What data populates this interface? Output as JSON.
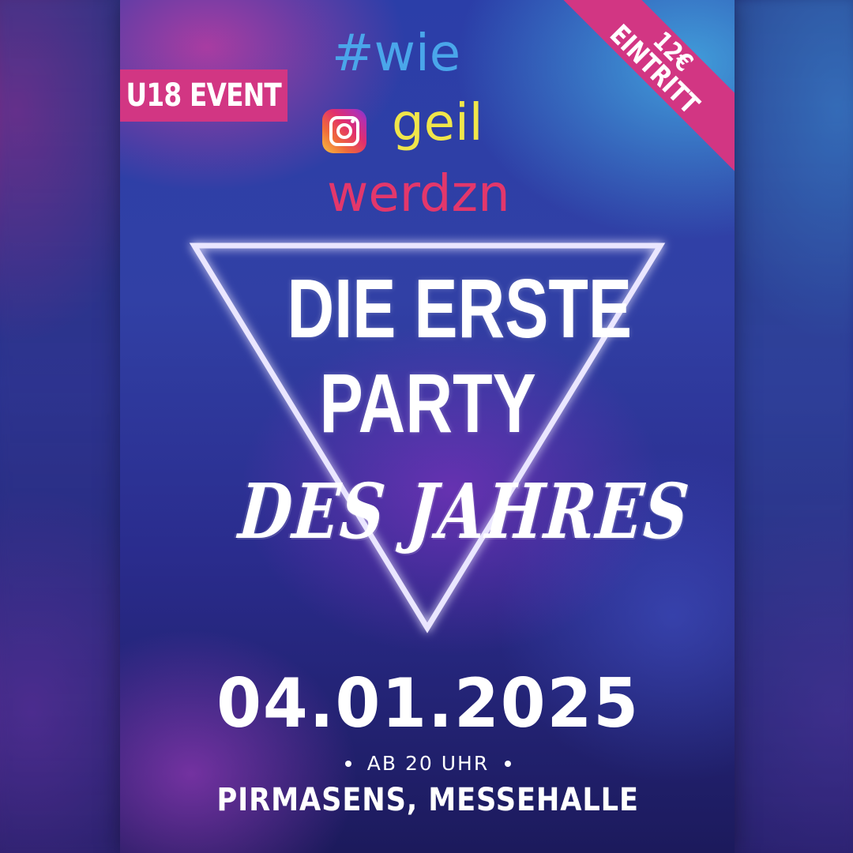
{
  "badge_u18": "U18 EVENT",
  "corner_badge": {
    "line1": "12€",
    "line2": "EINTRITT"
  },
  "handle": {
    "line1": "#wie",
    "line2": "geil",
    "line3": "werdzn",
    "icon": "instagram-icon"
  },
  "headline": {
    "line1": "DIE ERSTE",
    "line2": "PARTY",
    "line3": "DES JAHRES"
  },
  "date": "04.01.2025",
  "time": "AB 20 UHR",
  "venue": "PIRMASENS, MESSEHALLE",
  "colors": {
    "accent_pink": "#d23683",
    "handle_blue": "#4aa6ea",
    "handle_yellow": "#f0e64a",
    "handle_red": "#e3376b",
    "text": "#ffffff"
  }
}
